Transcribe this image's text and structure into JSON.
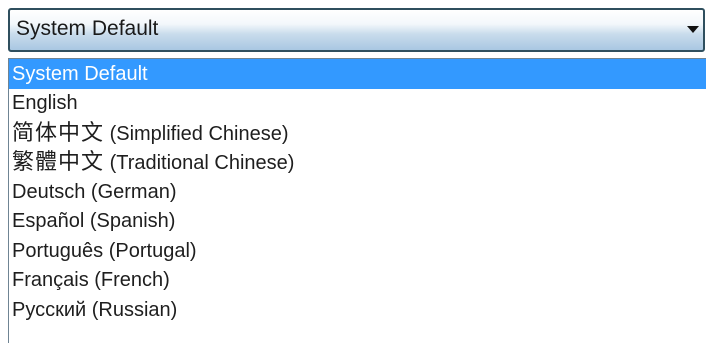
{
  "select": {
    "value": "System Default",
    "arrow_icon": "chevron-down-icon"
  },
  "options": [
    {
      "label": "System Default",
      "selected": true
    },
    {
      "label": "English"
    },
    {
      "native": "简体中文",
      "label": " (Simplified Chinese)"
    },
    {
      "native": "繁體中文",
      "label": " (Traditional Chinese)"
    },
    {
      "label": "Deutsch (German)"
    },
    {
      "label": "Español (Spanish)"
    },
    {
      "label": "Português (Portugal)"
    },
    {
      "label": "Français (French)"
    },
    {
      "label": "Русский (Russian)"
    }
  ],
  "colors": {
    "selected_bg": "#3399ff",
    "selected_text": "#ffffff"
  }
}
